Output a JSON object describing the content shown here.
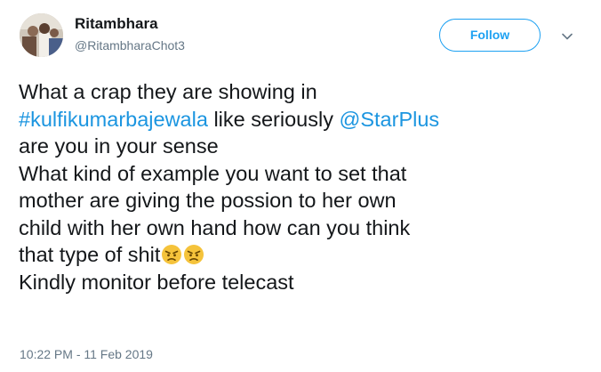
{
  "user": {
    "display_name": "Ritambhara",
    "handle": "@RitambharaChot3"
  },
  "follow_button": {
    "label": "Follow"
  },
  "tweet": {
    "line1": "What a crap they are showing in",
    "hashtag": "#kulfikumarbajewala",
    "line2_middle": " like seriously ",
    "mention": "@StarPlus",
    "line3": "are you in your sense",
    "line4": "What kind of example you want to set that",
    "line5": "mother are giving the possion to her own",
    "line6": "child with her own hand how can you think",
    "line7": "that type of shit",
    "line8": "Kindly monitor before telecast",
    "emojis": [
      "angry-face-icon",
      "angry-face-icon"
    ]
  },
  "timestamp": "10:22 PM - 11 Feb 2019",
  "colors": {
    "link": "#1b95e0",
    "follow": "#1da1f2",
    "text": "#14171a",
    "secondary": "#657786",
    "emoji_face": "#f5c33b"
  }
}
